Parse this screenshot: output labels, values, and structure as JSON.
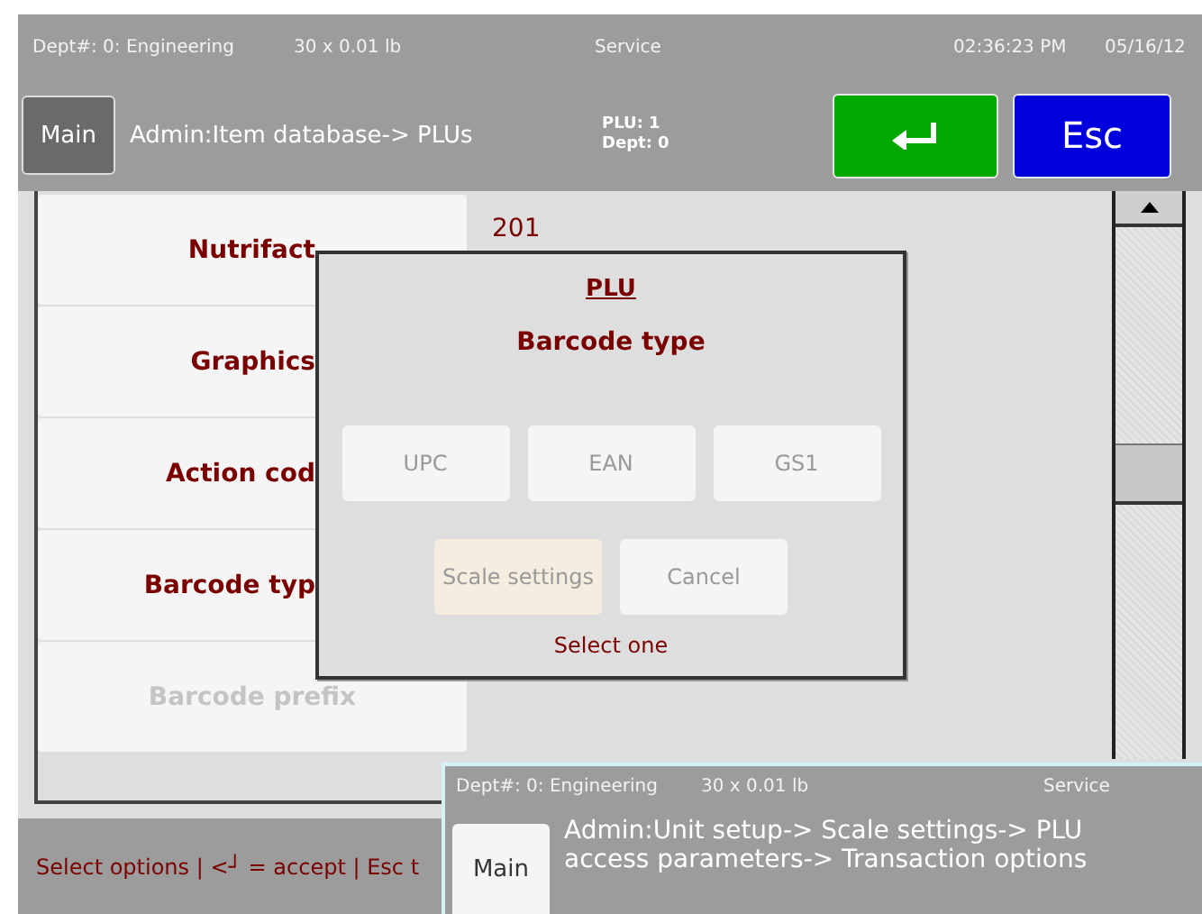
{
  "status_bar": {
    "department": "Dept#: 0: Engineering",
    "capacity": "30 x 0.01 lb",
    "mode": "Service",
    "time": "02:36:23 PM",
    "date": "05/16/12"
  },
  "header": {
    "main_button": "Main",
    "breadcrumb": "Admin:Item database-> PLUs",
    "plu": "PLU: 1",
    "dept": "Dept: 0",
    "escape_button": "Esc"
  },
  "fields": [
    {
      "label": "Nutrifact",
      "value": "201",
      "disabled": false
    },
    {
      "label": "Graphics",
      "disabled": false
    },
    {
      "label": "Action cod",
      "disabled": false
    },
    {
      "label": "Barcode typ",
      "disabled": false
    },
    {
      "label": "Barcode prefix",
      "disabled": true
    }
  ],
  "hint": "Select options | <┘ = accept | Esc t",
  "dialog": {
    "title": "PLU",
    "heading": "Barcode type",
    "options": [
      {
        "label": "UPC"
      },
      {
        "label": "EAN"
      },
      {
        "label": "GS1"
      }
    ],
    "actions": [
      {
        "label": "Scale settings",
        "selected": true
      },
      {
        "label": "Cancel",
        "selected": false
      }
    ],
    "prompt": "Select one"
  },
  "second_window": {
    "status_bar": {
      "department": "Dept#: 0: Engineering",
      "capacity": "30 x 0.01 lb",
      "mode": "Service"
    },
    "main_button": "Main",
    "breadcrumb": "Admin:Unit setup-> Scale settings-> PLU access parameters-> Transaction options"
  }
}
